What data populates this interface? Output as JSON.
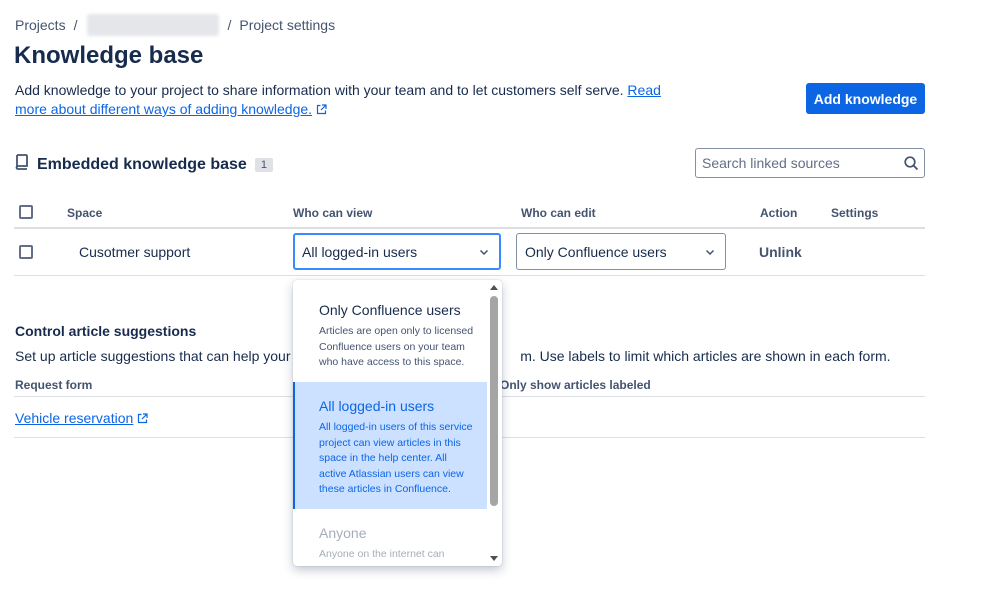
{
  "breadcrumb": {
    "projects": "Projects",
    "separator": "/",
    "current": "Project settings"
  },
  "page": {
    "title": "Knowledge base",
    "intro_text": "Add knowledge to your project to share information with your team and to let customers self serve. ",
    "intro_link": "Read more about different ways of adding knowledge."
  },
  "header": {
    "add_button": "Add knowledge"
  },
  "kb": {
    "title": "Embedded knowledge base",
    "count": "1",
    "search_placeholder": "Search linked sources",
    "columns": {
      "space": "Space",
      "who_can_view": "Who can view",
      "who_can_edit": "Who can edit",
      "action": "Action",
      "settings": "Settings"
    },
    "rows": [
      {
        "space": "Cusotmer support",
        "view": "All logged-in users",
        "edit": "Only Confluence users",
        "action": "Unlink"
      }
    ]
  },
  "suggestions": {
    "title": "Control article suggestions",
    "desc_start": "Set up article suggestions that can help your cu",
    "desc_end": "m. Use labels to limit which articles are shown in each form.",
    "col_request_form": "Request form",
    "col_labels": "Only show articles labeled",
    "rows": [
      {
        "form": "Vehicle reservation"
      }
    ]
  },
  "dropdown": {
    "options": [
      {
        "title": "Only Confluence users",
        "desc": "Articles are open only to licensed Confluence users on your team who have access to this space."
      },
      {
        "title": "All logged-in users",
        "desc": "All logged-in users of this service project can view articles in this space in the help center. All active Atlassian users can view these articles in Confluence."
      },
      {
        "title": "Anyone",
        "desc": "Anyone on the internet can"
      }
    ],
    "selected_index": 1
  }
}
